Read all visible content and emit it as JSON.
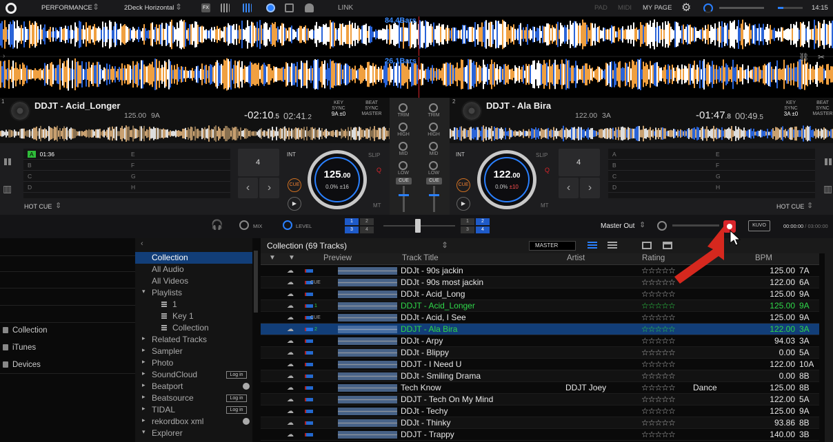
{
  "topbar": {
    "mode": "PERFORMANCE",
    "layout": "2Deck Horizontal",
    "link": "LINK",
    "pad": "PAD",
    "midi": "MIDI",
    "my_page": "MY PAGE",
    "clock": "14:15"
  },
  "waveform": {
    "deck1_bars": "84.4Bars",
    "deck2_bars": "26.1Bars"
  },
  "deck1": {
    "number": "1",
    "title": "DDJT - Acid_Longer",
    "bpm": "125.00",
    "key": "9A",
    "remain_big": "-02:10",
    "remain_small": ".5",
    "elapsed_big": "02:41",
    "elapsed_small": ".2",
    "key_sync": "KEY SYNC",
    "key_val": "9A",
    "key_shift": "±0",
    "beat_sync": "BEAT SYNC",
    "master": "MASTER",
    "hotcue_a_time": "01:36",
    "hotcues": [
      "A",
      "B",
      "C",
      "D",
      "E",
      "F",
      "G",
      "H"
    ],
    "hotcue_label": "HOT CUE",
    "beat_count": "4",
    "int": "INT",
    "slip": "SLIP",
    "q": "Q",
    "mt": "MT",
    "cue": "CUE",
    "jog_bpm": "125",
    "jog_bpm_dec": ".00",
    "jog_pitch": "0.0%",
    "jog_range": "±16"
  },
  "deck2": {
    "number": "2",
    "title": "DDJT - Ala Bira",
    "bpm": "122.00",
    "key": "3A",
    "remain_big": "-01:47",
    "remain_small": ".8",
    "elapsed_big": "00:49",
    "elapsed_small": ".5",
    "key_sync": "KEY SYNC",
    "key_val": "3A",
    "key_shift": "±0",
    "beat_sync": "BEAT SYNC",
    "master": "MASTER",
    "hotcues": [
      "A",
      "B",
      "C",
      "D",
      "E",
      "F",
      "G",
      "H"
    ],
    "hotcue_label": "HOT CUE",
    "beat_count": "4",
    "int": "INT",
    "slip": "SLIP",
    "q": "Q",
    "mt": "MT",
    "cue": "CUE",
    "jog_bpm": "122",
    "jog_bpm_dec": ".00",
    "jog_pitch": "0.0%",
    "jog_range": "±10"
  },
  "mixer": {
    "trim": "TRIM",
    "high": "HIGH",
    "mid": "MID",
    "low": "LOW",
    "cue": "CUE"
  },
  "mixerbar": {
    "mix": "MIX",
    "level": "LEVEL",
    "fx_left": [
      "1",
      "2",
      "3",
      "4"
    ],
    "fx_right": [
      "1",
      "2",
      "3",
      "4"
    ],
    "master_out": "Master Out",
    "kuvo": "KUVO",
    "rec_time": "00:00:00",
    "rec_total": "/ 03:00:00"
  },
  "leftnav": {
    "items": [
      "Collection",
      "iTunes",
      "Devices"
    ]
  },
  "tree": {
    "items": [
      {
        "label": "Collection",
        "indent": 0,
        "arrow": ""
      },
      {
        "label": "All Audio",
        "indent": 0,
        "arrow": ""
      },
      {
        "label": "All Videos",
        "indent": 0,
        "arrow": ""
      },
      {
        "label": "Playlists",
        "indent": 0,
        "arrow": "▾"
      },
      {
        "label": "1",
        "indent": 2,
        "arrow": ""
      },
      {
        "label": "Key 1",
        "indent": 2,
        "arrow": ""
      },
      {
        "label": "Collection",
        "indent": 2,
        "arrow": ""
      },
      {
        "label": "Related Tracks",
        "indent": 0,
        "arrow": "▸"
      },
      {
        "label": "Sampler",
        "indent": 0,
        "arrow": "▸"
      },
      {
        "label": "Photo",
        "indent": 0,
        "arrow": "▸"
      },
      {
        "label": "SoundCloud",
        "indent": 0,
        "arrow": "▸",
        "badge": "Log in"
      },
      {
        "label": "Beatport",
        "indent": 0,
        "arrow": "▸"
      },
      {
        "label": "Beatsource",
        "indent": 0,
        "arrow": "▸",
        "badge": "Log in"
      },
      {
        "label": "TIDAL",
        "indent": 0,
        "arrow": "▸",
        "badge": "Log in"
      },
      {
        "label": "rekordbox xml",
        "indent": 0,
        "arrow": "▸"
      },
      {
        "label": "Explorer",
        "indent": 0,
        "arrow": "▾"
      }
    ]
  },
  "collection": {
    "header": "Collection (69 Tracks)",
    "master_btn": "MASTER",
    "columns": [
      "Preview",
      "Track Title",
      "Artist",
      "Rating",
      "BPM"
    ]
  },
  "tracks": [
    {
      "title": "DDJt - 90s jackin",
      "artist": "",
      "genre": "",
      "bpm": "125.00",
      "key": "7A",
      "deck": "",
      "cue": ""
    },
    {
      "title": "DDJt - 90s most jackin",
      "artist": "",
      "genre": "",
      "bpm": "122.00",
      "key": "6A",
      "deck": "",
      "cue": "CUE"
    },
    {
      "title": "DDJt - Acid_Long",
      "artist": "",
      "genre": "",
      "bpm": "125.00",
      "key": "9A",
      "deck": "",
      "cue": ""
    },
    {
      "title": "DDJT - Acid_Longer",
      "artist": "",
      "genre": "",
      "bpm": "125.00",
      "key": "9A",
      "deck": "1",
      "cue": ""
    },
    {
      "title": "DDJt - Acid, I See",
      "artist": "",
      "genre": "",
      "bpm": "125.00",
      "key": "9A",
      "deck": "",
      "cue": "CUE"
    },
    {
      "title": "DDJT - Ala Bira",
      "artist": "",
      "genre": "",
      "bpm": "122.00",
      "key": "3A",
      "deck": "2",
      "cue": ""
    },
    {
      "title": "DDJt - Arpy",
      "artist": "",
      "genre": "",
      "bpm": "94.03",
      "key": "3A",
      "deck": "",
      "cue": ""
    },
    {
      "title": "DDJt - Blippy",
      "artist": "",
      "genre": "",
      "bpm": "0.00",
      "key": "5A",
      "deck": "",
      "cue": ""
    },
    {
      "title": "DDJT - I Need U",
      "artist": "",
      "genre": "",
      "bpm": "122.00",
      "key": "10A",
      "deck": "",
      "cue": ""
    },
    {
      "title": "DDJt - Smiling Drama",
      "artist": "",
      "genre": "",
      "bpm": "0.00",
      "key": "8B",
      "deck": "",
      "cue": ""
    },
    {
      "title": "Tech Know",
      "artist": "DDJT Joey",
      "genre": "Dance",
      "bpm": "125.00",
      "key": "8B",
      "deck": "",
      "cue": ""
    },
    {
      "title": "DDJT - Tech On My Mind",
      "artist": "",
      "genre": "",
      "bpm": "122.00",
      "key": "5A",
      "deck": "",
      "cue": ""
    },
    {
      "title": "DDJt - Techy",
      "artist": "",
      "genre": "",
      "bpm": "125.00",
      "key": "9A",
      "deck": "",
      "cue": ""
    },
    {
      "title": "DDJt - Thinky",
      "artist": "",
      "genre": "",
      "bpm": "93.86",
      "key": "8B",
      "deck": "",
      "cue": ""
    },
    {
      "title": "DDJT - Trappy",
      "artist": "",
      "genre": "",
      "bpm": "140.00",
      "key": "3B",
      "deck": "",
      "cue": ""
    }
  ],
  "colors": {
    "accent_blue": "#2a80ff",
    "selected_row": "#123e78",
    "loaded_green": "#2fd84a",
    "rec_red": "#d9252b",
    "arrow_red": "#d6281e",
    "wave_orange": "#f0a040",
    "wave_blue": "#2a64d8"
  }
}
